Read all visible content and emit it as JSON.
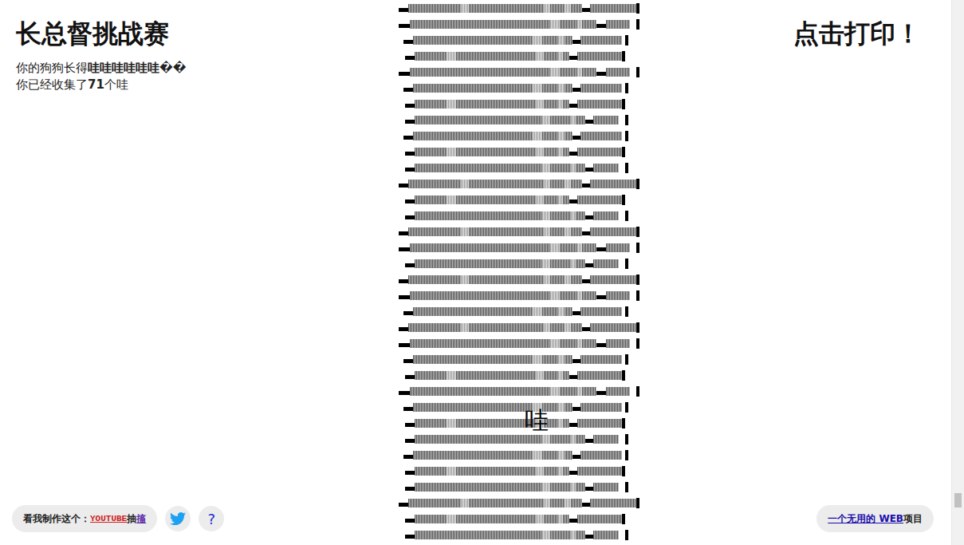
{
  "title": "长总督挑战赛",
  "dog_length": {
    "prefix": "你的狗狗长得",
    "value": "哇哇哇哇哇哇��"
  },
  "collected": {
    "prefix": "你已经收集了",
    "count": "71",
    "suffix": "个哇"
  },
  "print_button": "点击打印！",
  "floating_text": "哇",
  "footer_left": {
    "label": "看我制作这个：",
    "youtube": "YOUTUBE",
    "twitch": "抽搐",
    "help": "?"
  },
  "footer_right": {
    "link": "一个无用的 WEB",
    "suffix": "项目"
  },
  "scrollbar": {
    "level": 0.93
  }
}
